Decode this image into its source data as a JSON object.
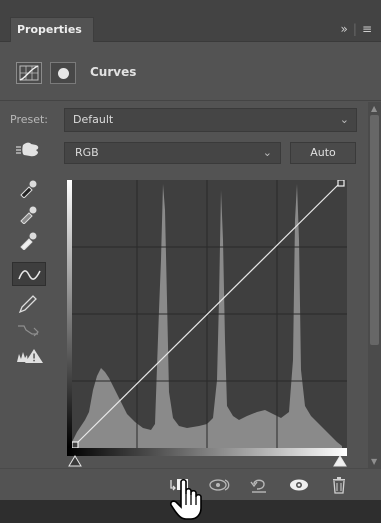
{
  "tabbar": {
    "tab_label": "Properties",
    "overflow_glyph": "»",
    "menu_glyph": "≡"
  },
  "header": {
    "title": "Curves",
    "icons": [
      "curves-adjustment-icon",
      "mask-icon"
    ]
  },
  "preset": {
    "label": "Preset:",
    "value": "Default"
  },
  "channel": {
    "value": "RGB",
    "auto_label": "Auto"
  },
  "tools": [
    "sample-black-point-eyedropper-icon",
    "sample-gray-point-eyedropper-icon",
    "sample-white-point-eyedropper-icon",
    "edit-points-curve-icon",
    "pencil-draw-icon",
    "smooth-curve-icon",
    "clipping-warning-icon"
  ],
  "footer": {
    "buttons": [
      "clip-to-layer-icon",
      "view-previous-state-icon",
      "reset-icon",
      "visibility-eye-icon",
      "trash-icon"
    ]
  },
  "colors": {
    "panel_bg": "#535353",
    "histogram": "#8a8a8a",
    "graph_bg": "#3f3f3f"
  }
}
